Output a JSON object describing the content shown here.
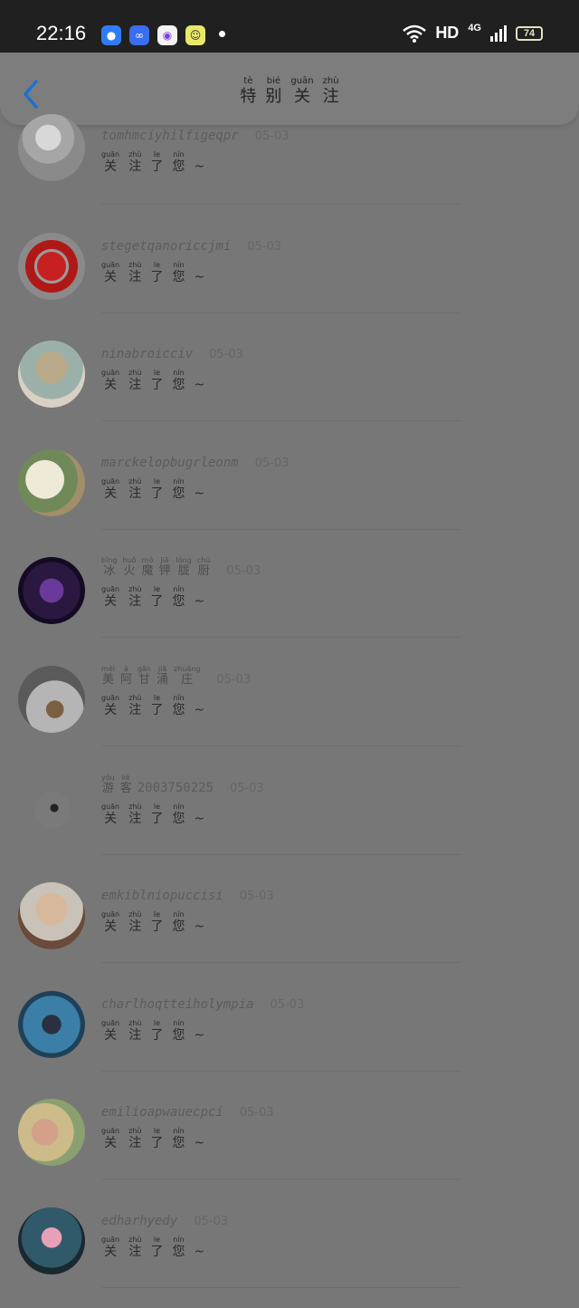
{
  "status": {
    "time": "22:16",
    "hd": "HD",
    "network": "4G",
    "battery": "74"
  },
  "header": {
    "title": [
      {
        "py": "tè",
        "hz": "特"
      },
      {
        "py": "bié",
        "hz": "别"
      },
      {
        "py": "guān",
        "hz": "关"
      },
      {
        "py": "zhù",
        "hz": "注"
      }
    ]
  },
  "followed_text": [
    {
      "py": "guān",
      "hz": "关"
    },
    {
      "py": "zhù",
      "hz": "注"
    },
    {
      "py": "le",
      "hz": "了"
    },
    {
      "py": "nín",
      "hz": "您"
    }
  ],
  "followed_suffix": "~",
  "rows": [
    {
      "name": "tomhmciyhilfigeqpr",
      "date": "05-03"
    },
    {
      "name": "stegetqanoriccjmi",
      "date": "05-03"
    },
    {
      "name": "ninabroicciv",
      "date": "05-03"
    },
    {
      "name": "marckelopbugrleonm",
      "date": "05-03"
    },
    {
      "name_chars": [
        {
          "py": "bīng",
          "hz": "冰"
        },
        {
          "py": "huǒ",
          "hz": "火"
        },
        {
          "py": "mó",
          "hz": "魔"
        },
        {
          "py": "jiā",
          "hz": "钾"
        },
        {
          "py": "lóng",
          "hz": "胧"
        },
        {
          "py": "chú",
          "hz": "厨"
        }
      ],
      "date": "05-03"
    },
    {
      "name_chars": [
        {
          "py": "měi",
          "hz": "美"
        },
        {
          "py": "ā",
          "hz": "阿"
        },
        {
          "py": "gān",
          "hz": "甘"
        },
        {
          "py": "jiā",
          "hz": "涌"
        },
        {
          "py": "zhuāng",
          "hz": "庄"
        }
      ],
      "date": "05-03"
    },
    {
      "name_chars": [
        {
          "py": "yóu",
          "hz": "游"
        },
        {
          "py": "kè",
          "hz": "客"
        }
      ],
      "name_suffix": "2003750225",
      "date": "05-03"
    },
    {
      "name": "emkiblniopuccisi",
      "date": "05-03"
    },
    {
      "name": "charlhoqtteiholympia",
      "date": "05-03"
    },
    {
      "name": "emilioapwauecpci",
      "date": "05-03"
    },
    {
      "name": "edharhyedy",
      "date": "05-03"
    }
  ]
}
